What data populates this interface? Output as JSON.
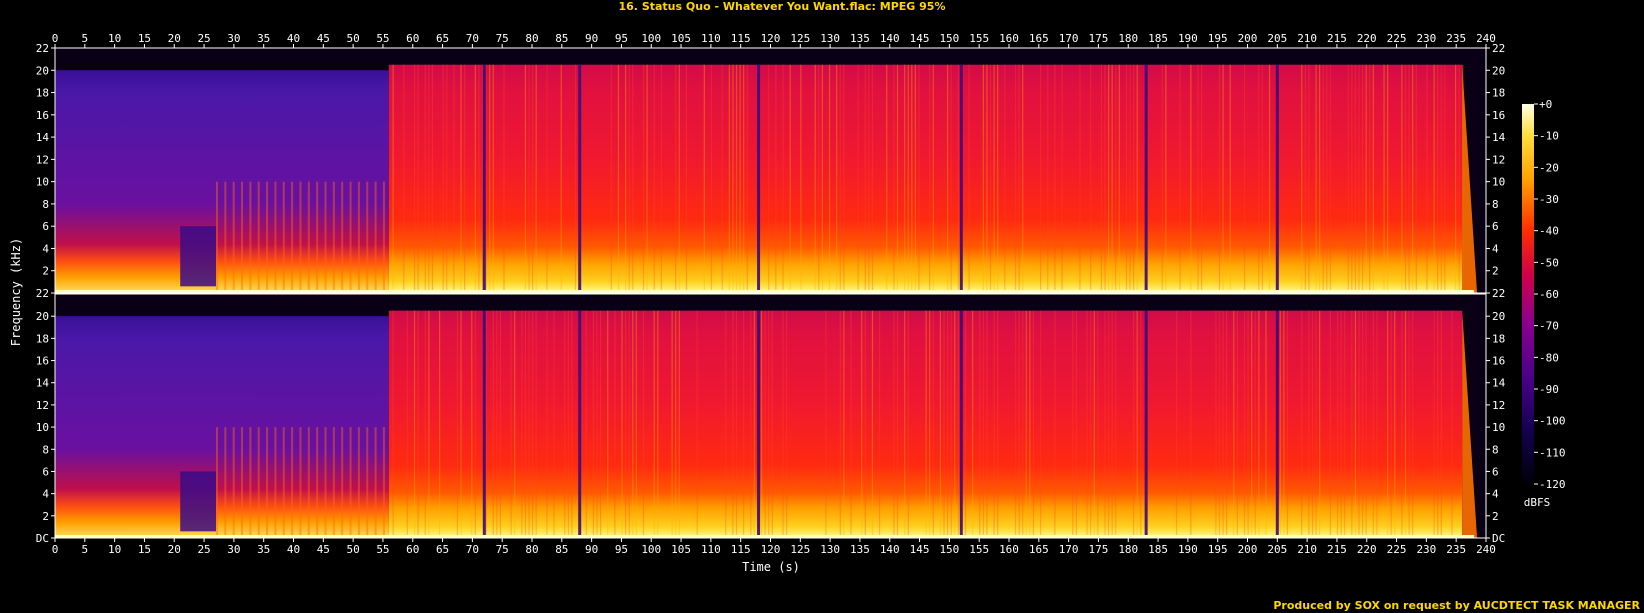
{
  "chart_data": {
    "type": "heatmap",
    "title": "16. Status Quo - Whatever You Want.flac: MPEG 95%",
    "xlabel": "Time (s)",
    "ylabel": "Frequency (kHz)",
    "footer": "Produced by SOX on request by AUCDTECT TASK MANAGER",
    "x_ticks": [
      0,
      5,
      10,
      15,
      20,
      25,
      30,
      35,
      40,
      45,
      50,
      55,
      60,
      65,
      70,
      75,
      80,
      85,
      90,
      95,
      100,
      105,
      110,
      115,
      120,
      125,
      130,
      135,
      140,
      145,
      150,
      155,
      160,
      165,
      170,
      175,
      180,
      185,
      190,
      195,
      200,
      205,
      210,
      215,
      220,
      225,
      230,
      235,
      240
    ],
    "xlim": [
      0,
      240
    ],
    "y_ticks": [
      {
        "value": 0,
        "label": "DC"
      },
      {
        "value": 2,
        "label": "2"
      },
      {
        "value": 4,
        "label": "4"
      },
      {
        "value": 6,
        "label": "6"
      },
      {
        "value": 8,
        "label": "8"
      },
      {
        "value": 10,
        "label": "10"
      },
      {
        "value": 12,
        "label": "12"
      },
      {
        "value": 14,
        "label": "14"
      },
      {
        "value": 16,
        "label": "16"
      },
      {
        "value": 18,
        "label": "18"
      },
      {
        "value": 20,
        "label": "20"
      },
      {
        "value": 22,
        "label": "22"
      }
    ],
    "ylim": [
      0,
      22
    ],
    "channels": 2,
    "colorbar": {
      "unit": "dBFS",
      "range": [
        -120,
        0
      ],
      "ticks": [
        "+0",
        "-10",
        "-20",
        "-30",
        "-40",
        "-50",
        "-60",
        "-70",
        "-80",
        "-90",
        "-100",
        "-110",
        "-120"
      ],
      "colors": [
        "#ffffe8",
        "#ffd700",
        "#ff8c00",
        "#ff2a00",
        "#d0004a",
        "#8a0088",
        "#4a0080",
        "#1a0050",
        "#000010"
      ]
    },
    "spectrogram_description": {
      "intro_end_s": 56,
      "intro_cutoff_khz": 20,
      "main_cutoff_khz": 20.5,
      "fade_out_s": 236,
      "dropouts_s": [
        72,
        88,
        118,
        152,
        183,
        205
      ]
    }
  }
}
